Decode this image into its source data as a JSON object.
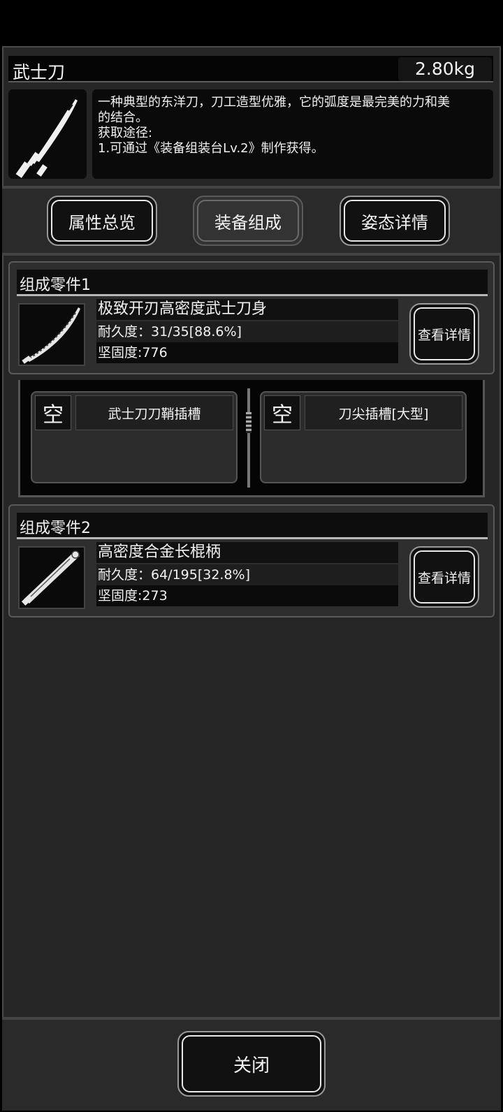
{
  "item": {
    "name": "武士刀",
    "weight": "2.80kg",
    "icon": "katana-icon",
    "description": [
      "一种典型的东洋刀，刀工造型优雅，它的弧度是最完美的力和美",
      "的结合。",
      "获取途径:",
      "1.可通过《装备组装台Lv.2》制作获得。"
    ]
  },
  "tabs": [
    {
      "label": "属性总览",
      "active": false
    },
    {
      "label": "装备组成",
      "active": true
    },
    {
      "label": "姿态详情",
      "active": false
    }
  ],
  "components": [
    {
      "header": "组成零件1",
      "icon": "blade-icon",
      "name": "极致开刃高密度武士刀身",
      "durability": "耐久度：31/35[88.6%]",
      "hardness": "坚固度:776",
      "detail_label": "查看详情"
    },
    {
      "header": "组成零件2",
      "icon": "handle-icon",
      "name": "高密度合金长棍柄",
      "durability": "耐久度：64/195[32.8%]",
      "hardness": "坚固度:273",
      "detail_label": "查看详情"
    }
  ],
  "sockets": [
    {
      "status": "空",
      "label": "武士刀刀鞘插槽"
    },
    {
      "status": "空",
      "label": "刀尖插槽[大型]"
    }
  ],
  "close_label": "关闭",
  "colors": {
    "panel": "#262626",
    "card": "#2e2e2e",
    "text": "#f2f2f2",
    "button_border": "#e8e8e8"
  }
}
